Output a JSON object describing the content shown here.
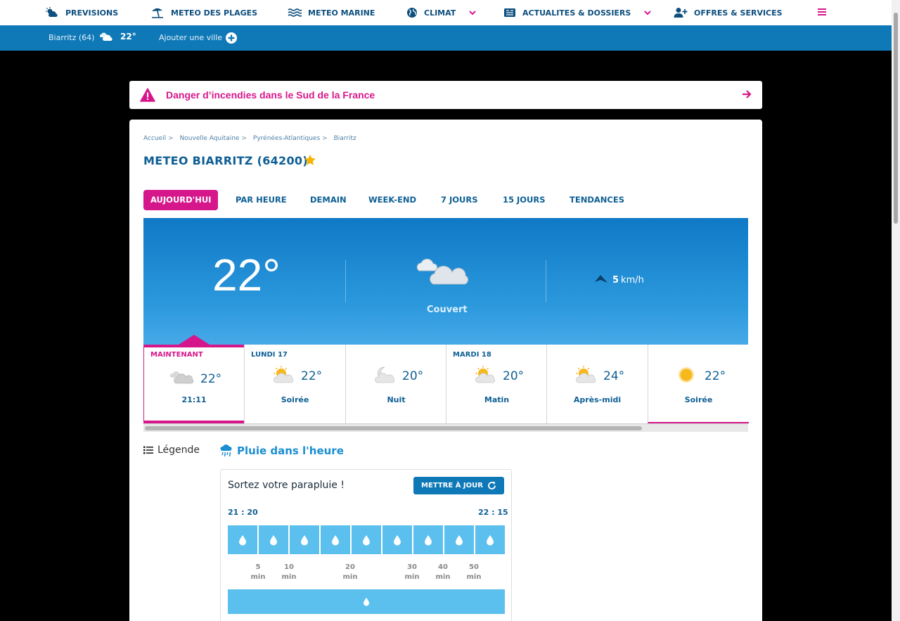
{
  "nav": {
    "items": [
      {
        "label": "PREVISIONS",
        "icon": "sun-cloud-icon"
      },
      {
        "label": "METEO DES PLAGES",
        "icon": "umbrella-beach-icon"
      },
      {
        "label": "METEO MARINE",
        "icon": "waves-icon"
      },
      {
        "label": "CLIMAT",
        "icon": "globe-icon"
      },
      {
        "label": "ACTUALITES & DOSSIERS",
        "icon": "newspaper-icon"
      },
      {
        "label": "OFFRES & SERVICES",
        "icon": "user-plus-icon"
      }
    ],
    "menu_icon": "hamburger-menu-icon"
  },
  "citybar": {
    "city": "Biarritz (64)",
    "temp": "22°",
    "add_label": "Ajouter une ville"
  },
  "alert": {
    "text": "Danger d’incendies dans le Sud de la France"
  },
  "breadcrumb": [
    "Accueil",
    "Nouvelle Aquitaine",
    "Pyrénées-Atlantiques",
    "Biarritz"
  ],
  "page_title": "METEO BIARRITZ (64200)",
  "tabs": [
    "AUJOURD'HUI",
    "PAR HEURE",
    "DEMAIN",
    "WEEK-END",
    "7 JOURS",
    "15 JOURS",
    "TENDANCES"
  ],
  "current": {
    "temp": "22°",
    "condition": "Couvert",
    "wind_value": "5",
    "wind_unit": "km/h"
  },
  "slots": [
    {
      "day": "MAINTENANT",
      "temp": "22°",
      "label": "21:11",
      "icon": "clouds-icon"
    },
    {
      "day": "LUNDI 17",
      "temp": "22°",
      "label": "Soirée",
      "icon": "sun-cloud-icon"
    },
    {
      "day": "",
      "temp": "20°",
      "label": "Nuit",
      "icon": "moon-cloud-icon"
    },
    {
      "day": "MARDI 18",
      "temp": "20°",
      "label": "Matin",
      "icon": "sun-cloud-icon"
    },
    {
      "day": "",
      "temp": "24°",
      "label": "Après-midi",
      "icon": "sun-cloud-icon"
    },
    {
      "day": "",
      "temp": "22°",
      "label": "Soirée",
      "icon": "sun-icon"
    }
  ],
  "legend_label": "Légende",
  "rain": {
    "heading": "Pluie dans l'heure",
    "message": "Sortez votre parapluie !",
    "update_label": "METTRE À JOUR",
    "start_time": "21 : 20",
    "end_time": "22 : 15",
    "minutes": [
      {
        "value": "5",
        "unit": "min"
      },
      {
        "value": "10",
        "unit": "min"
      },
      {
        "value": "20",
        "unit": "min"
      },
      {
        "value": "30",
        "unit": "min"
      },
      {
        "value": "40",
        "unit": "min"
      },
      {
        "value": "50",
        "unit": "min"
      }
    ]
  },
  "colors": {
    "brand_blue": "#0f79b8",
    "accent_pink": "#d6178b",
    "rain_blue": "#5cc0ee"
  }
}
